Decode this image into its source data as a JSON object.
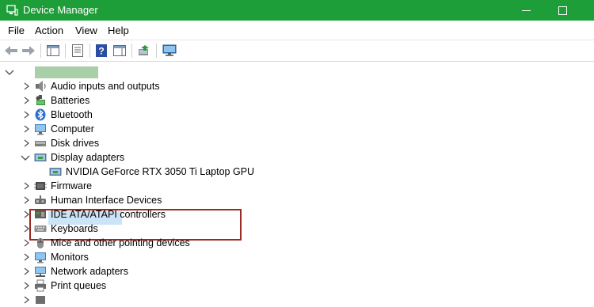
{
  "window": {
    "title": "Device Manager"
  },
  "menu": [
    "File",
    "Action",
    "View",
    "Help"
  ],
  "toolbar": {
    "buttons": [
      "back-arrow",
      "forward-arrow",
      "show-hide-console-tree",
      "properties",
      "help",
      "action-pane",
      "update-driver",
      "scan-hardware-monitor"
    ]
  },
  "tree": {
    "root_label": "",
    "categories": [
      {
        "label": "Audio inputs and outputs",
        "icon": "speaker-icon",
        "expanded": false
      },
      {
        "label": "Batteries",
        "icon": "battery-icon",
        "expanded": false
      },
      {
        "label": "Bluetooth",
        "icon": "bluetooth-icon",
        "expanded": false
      },
      {
        "label": "Computer",
        "icon": "computer-icon",
        "expanded": false
      },
      {
        "label": "Disk drives",
        "icon": "disk-drive-icon",
        "expanded": false
      },
      {
        "label": "Display adapters",
        "icon": "display-adapter-icon",
        "expanded": true,
        "selected": true
      },
      {
        "label": "NVIDIA GeForce RTX 3050 Ti Laptop GPU",
        "icon": "display-adapter-icon",
        "child": true
      },
      {
        "label": "Firmware",
        "icon": "firmware-icon",
        "expanded": false
      },
      {
        "label": "Human Interface Devices",
        "icon": "hid-icon",
        "expanded": false
      },
      {
        "label": "IDE ATA/ATAPI controllers",
        "icon": "ide-controller-icon",
        "expanded": false
      },
      {
        "label": "Keyboards",
        "icon": "keyboard-icon",
        "expanded": false
      },
      {
        "label": "Mice and other pointing devices",
        "icon": "mouse-icon",
        "expanded": false
      },
      {
        "label": "Monitors",
        "icon": "monitor-icon",
        "expanded": false
      },
      {
        "label": "Network adapters",
        "icon": "network-adapter-icon",
        "expanded": false
      },
      {
        "label": "Print queues",
        "icon": "printer-icon",
        "expanded": false
      }
    ]
  },
  "colors": {
    "titlebar": "#1e9e38",
    "highlight_border": "#9a2a22",
    "selection": "#cce4f7"
  }
}
